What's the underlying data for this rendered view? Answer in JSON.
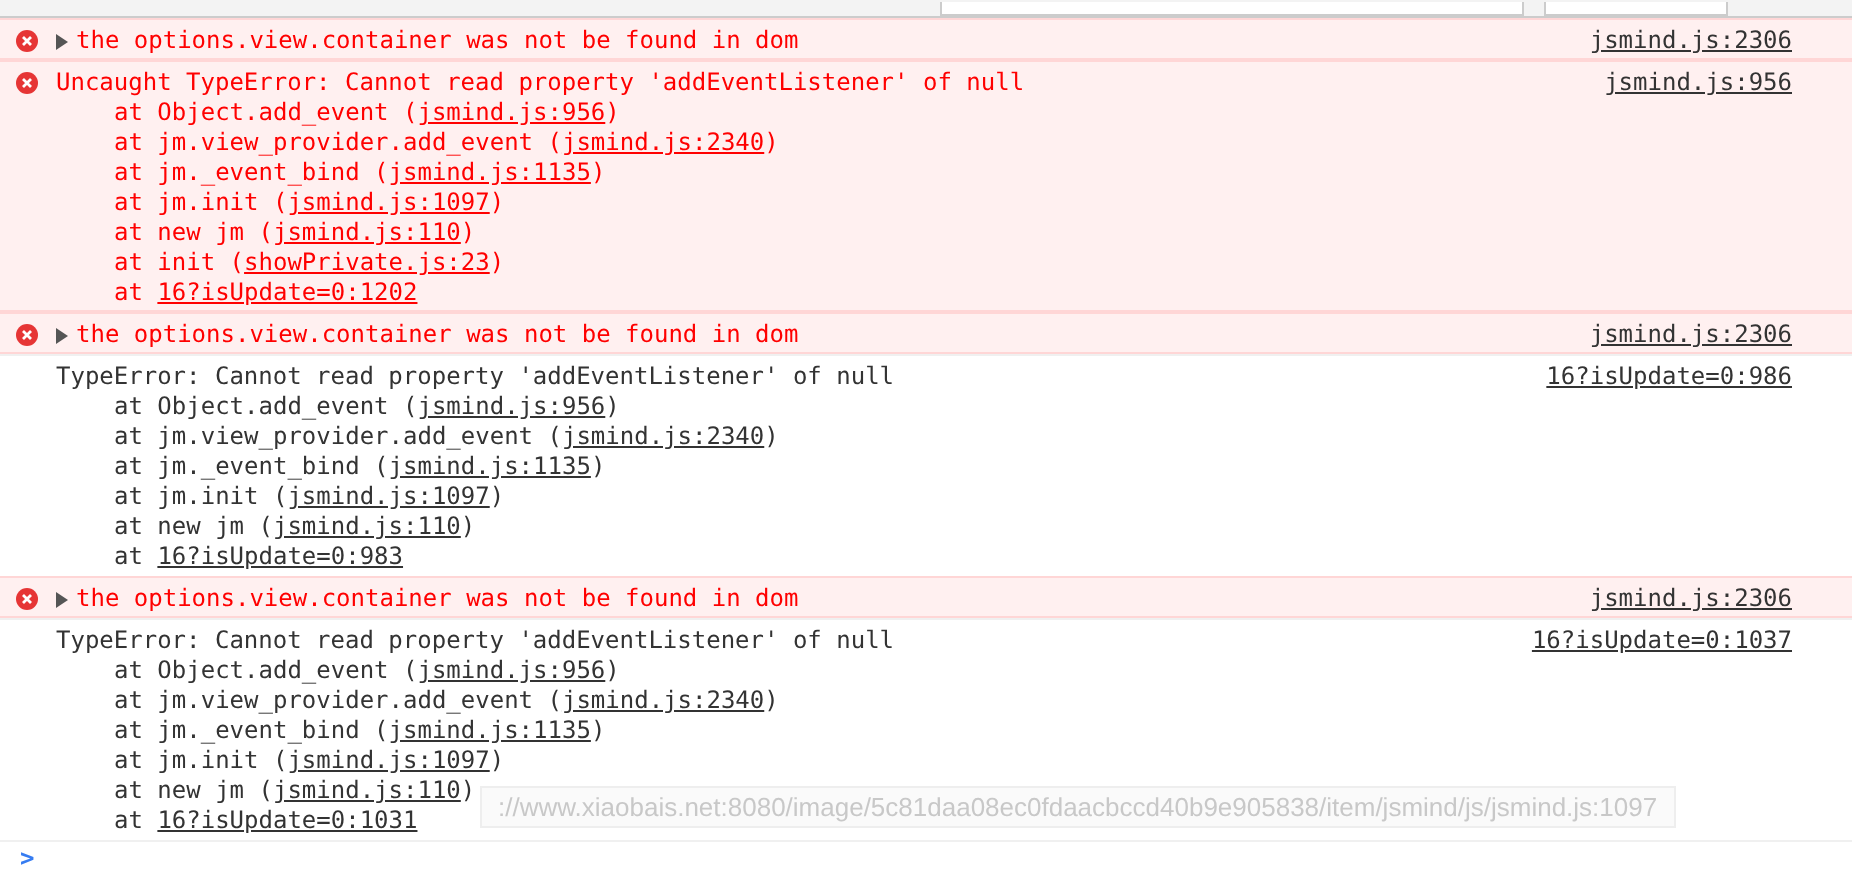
{
  "messages": [
    {
      "kind": "error",
      "collapsed": true,
      "text": "the options.view.container was not be found in dom",
      "source": "jsmind.js:2306"
    },
    {
      "kind": "error",
      "collapsed": false,
      "text": "Uncaught TypeError: Cannot read property 'addEventListener' of null",
      "source": "jsmind.js:956",
      "stack": [
        {
          "before": "at Object.add_event (",
          "link": "jsmind.js:956",
          "after": ")"
        },
        {
          "before": "at jm.view_provider.add_event (",
          "link": "jsmind.js:2340",
          "after": ")"
        },
        {
          "before": "at jm._event_bind (",
          "link": "jsmind.js:1135",
          "after": ")"
        },
        {
          "before": "at jm.init (",
          "link": "jsmind.js:1097",
          "after": ")"
        },
        {
          "before": "at new jm (",
          "link": "jsmind.js:110",
          "after": ")"
        },
        {
          "before": "at init (",
          "link": "showPrivate.js:23",
          "after": ")"
        },
        {
          "before": "at ",
          "link": "16?isUpdate=0:1202"
        }
      ]
    },
    {
      "kind": "error",
      "collapsed": true,
      "text": "the options.view.container was not be found in dom",
      "source": "jsmind.js:2306"
    },
    {
      "kind": "plain",
      "collapsed": false,
      "text": "TypeError: Cannot read property 'addEventListener' of null",
      "source": "16?isUpdate=0:986",
      "stack": [
        {
          "before": "at Object.add_event (",
          "link": "jsmind.js:956",
          "after": ")"
        },
        {
          "before": "at jm.view_provider.add_event (",
          "link": "jsmind.js:2340",
          "after": ")"
        },
        {
          "before": "at jm._event_bind (",
          "link": "jsmind.js:1135",
          "after": ")"
        },
        {
          "before": "at jm.init (",
          "link": "jsmind.js:1097",
          "after": ")"
        },
        {
          "before": "at new jm (",
          "link": "jsmind.js:110",
          "after": ")"
        },
        {
          "before": "at ",
          "link": "16?isUpdate=0:983"
        }
      ]
    },
    {
      "kind": "error",
      "collapsed": true,
      "text": "the options.view.container was not be found in dom",
      "source": "jsmind.js:2306"
    },
    {
      "kind": "plain",
      "collapsed": false,
      "text": "TypeError: Cannot read property 'addEventListener' of null",
      "source": "16?isUpdate=0:1037",
      "stack": [
        {
          "before": "at Object.add_event (",
          "link": "jsmind.js:956",
          "after": ")"
        },
        {
          "before": "at jm.view_provider.add_event (",
          "link": "jsmind.js:2340",
          "after": ")"
        },
        {
          "before": "at jm._event_bind (",
          "link": "jsmind.js:1135",
          "after": ")"
        },
        {
          "before": "at jm.init (",
          "link": "jsmind.js:1097",
          "after": ")"
        },
        {
          "before": "at new jm (",
          "link": "jsmind.js:110",
          "after": ")"
        },
        {
          "before": "at ",
          "link": "16?isUpdate=0:1031"
        }
      ]
    }
  ],
  "tooltip": "://www.xiaobais.net:8080/image/5c81daa08ec0fdaacbccd40b9e905838/item/jsmind/js/jsmind.js:1097",
  "prompt": ">"
}
